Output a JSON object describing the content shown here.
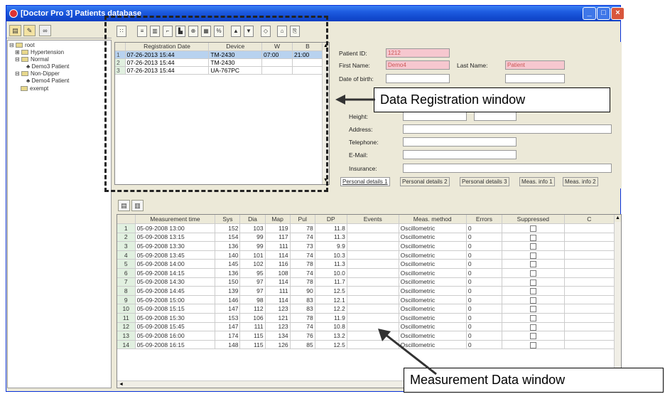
{
  "window": {
    "title": "[Doctor Pro 3] Patients database"
  },
  "tree": {
    "items": [
      "root",
      "Hypertension",
      "Normal",
      "Demo3 Patient",
      "Non-Dipper",
      "Demo4 Patient",
      "exempt"
    ]
  },
  "registration": {
    "headers": [
      "Registration Date",
      "Device",
      "W",
      "B"
    ],
    "rows": [
      {
        "n": "1",
        "date": "07-26-2013 15:44",
        "device": "TM-2430",
        "w": "07:00",
        "b": "21:00"
      },
      {
        "n": "2",
        "date": "07-26-2013 15:44",
        "device": "TM-2430",
        "w": "",
        "b": ""
      },
      {
        "n": "3",
        "date": "07-26-2013 15:44",
        "device": "UA-767PC",
        "w": "",
        "b": ""
      }
    ]
  },
  "details": {
    "patient_id_label": "Patient ID:",
    "patient_id": "1212",
    "first_name_label": "First Name:",
    "first_name": "Demo4",
    "last_name_label": "Last Name:",
    "last_name": "Patient",
    "dob_label": "Date of birth:",
    "height_label": "Height:",
    "address_label": "Address:",
    "telephone_label": "Telephone:",
    "email_label": "E-Mail:",
    "insurance_label": "Insurance:"
  },
  "tabs": [
    "Personal details 1",
    "Personal details 2",
    "Personal details 3",
    "Meas. info 1",
    "Meas. info 2"
  ],
  "callouts": {
    "registration": "Data Registration window",
    "measurement": "Measurement Data window"
  },
  "measurement": {
    "headers": [
      "Measurement time",
      "Sys",
      "Dia",
      "Map",
      "Pul",
      "DP",
      "Events",
      "Meas. method",
      "Errors",
      "Suppressed",
      "C"
    ],
    "rows": [
      [
        "1",
        "05-09-2008 13:00",
        "152",
        "103",
        "119",
        "78",
        "11.8",
        "",
        "Oscillometric",
        "0"
      ],
      [
        "2",
        "05-09-2008 13:15",
        "154",
        "99",
        "117",
        "74",
        "11.3",
        "",
        "Oscillometric",
        "0"
      ],
      [
        "3",
        "05-09-2008 13:30",
        "136",
        "99",
        "111",
        "73",
        "9.9",
        "",
        "Oscillometric",
        "0"
      ],
      [
        "4",
        "05-09-2008 13:45",
        "140",
        "101",
        "114",
        "74",
        "10.3",
        "",
        "Oscillometric",
        "0"
      ],
      [
        "5",
        "05-09-2008 14:00",
        "145",
        "102",
        "116",
        "78",
        "11.3",
        "",
        "Oscillometric",
        "0"
      ],
      [
        "6",
        "05-09-2008 14:15",
        "136",
        "95",
        "108",
        "74",
        "10.0",
        "",
        "Oscillometric",
        "0"
      ],
      [
        "7",
        "05-09-2008 14:30",
        "150",
        "97",
        "114",
        "78",
        "11.7",
        "",
        "Oscillometric",
        "0"
      ],
      [
        "8",
        "05-09-2008 14:45",
        "139",
        "97",
        "111",
        "90",
        "12.5",
        "",
        "Oscillometric",
        "0"
      ],
      [
        "9",
        "05-09-2008 15:00",
        "146",
        "98",
        "114",
        "83",
        "12.1",
        "",
        "Oscillometric",
        "0"
      ],
      [
        "10",
        "05-09-2008 15:15",
        "147",
        "112",
        "123",
        "83",
        "12.2",
        "",
        "Oscillometric",
        "0"
      ],
      [
        "11",
        "05-09-2008 15:30",
        "153",
        "106",
        "121",
        "78",
        "11.9",
        "",
        "Oscillometric",
        "0"
      ],
      [
        "12",
        "05-09-2008 15:45",
        "147",
        "111",
        "123",
        "74",
        "10.8",
        "",
        "Oscillometric",
        "0"
      ],
      [
        "13",
        "05-09-2008 16:00",
        "174",
        "115",
        "134",
        "76",
        "13.2",
        "",
        "Oscillometric",
        "0"
      ],
      [
        "14",
        "05-09-2008 16:15",
        "148",
        "115",
        "126",
        "85",
        "12.5",
        "",
        "Oscillometric",
        "0"
      ]
    ]
  }
}
